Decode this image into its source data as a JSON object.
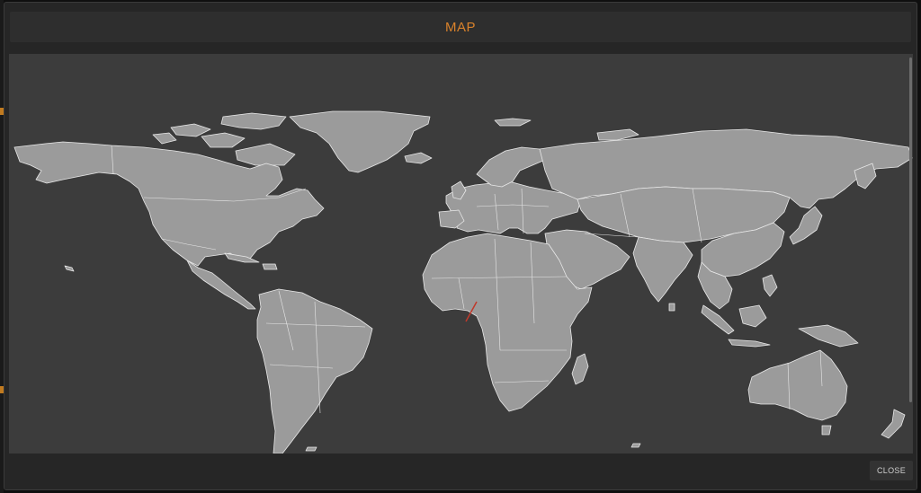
{
  "modal": {
    "title": "MAP",
    "close_label": "CLOSE"
  },
  "colors": {
    "title_accent": "#d9822b",
    "modal_background": "#262626",
    "map_background": "#3c3c3c",
    "land_fill": "#9b9b9b",
    "border_stroke": "#e8e8e8",
    "route_line": "#c0392b"
  },
  "map": {
    "projection": "world",
    "highlighted_route": "red-line-gulf-of-guinea"
  }
}
